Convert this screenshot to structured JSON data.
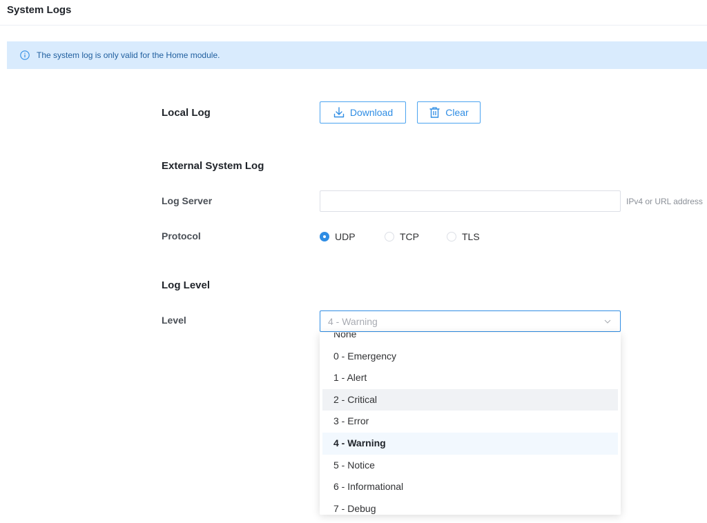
{
  "page": {
    "title": "System Logs"
  },
  "banner": {
    "icon": "info-icon",
    "text": "The system log is only valid for the Home module."
  },
  "local_log": {
    "label": "Local Log",
    "download_label": "Download",
    "download_icon": "download-icon",
    "clear_label": "Clear",
    "clear_icon": "trash-icon"
  },
  "external_log": {
    "label": "External System Log",
    "server_label": "Log Server",
    "server_value": "",
    "server_hint": "IPv4 or URL address",
    "protocol_label": "Protocol",
    "protocols": [
      {
        "label": "UDP",
        "checked": true
      },
      {
        "label": "TCP",
        "checked": false
      },
      {
        "label": "TLS",
        "checked": false
      }
    ]
  },
  "log_level": {
    "label": "Log Level",
    "level_label": "Level",
    "selected_value": "4 - Warning",
    "options": [
      "None",
      "0 - Emergency",
      "1 - Alert",
      "2 - Critical",
      "3 - Error",
      "4 - Warning",
      "5 - Notice",
      "6 - Informational",
      "7 - Debug"
    ],
    "hovered_option": "2 - Critical"
  },
  "colors": {
    "accent": "#2f8de4",
    "banner_bg": "#d9ebfd",
    "banner_text": "#1f5e9e"
  }
}
